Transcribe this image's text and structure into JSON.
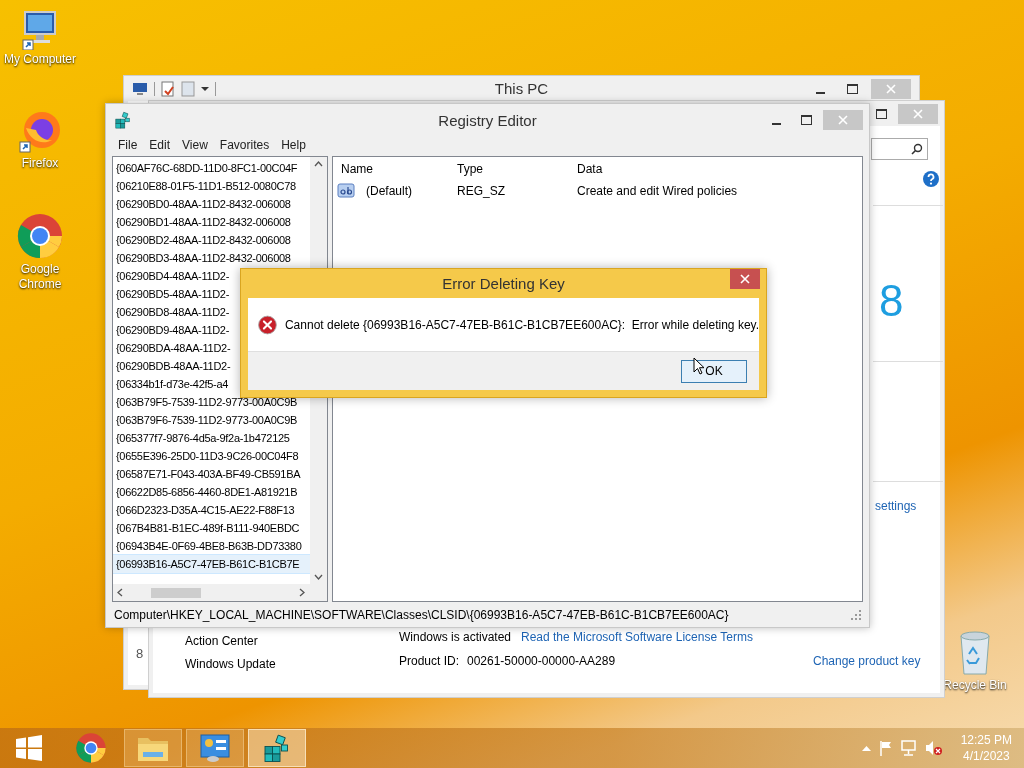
{
  "desktop_icons": [
    {
      "label": "My Computer",
      "kind": "computer"
    },
    {
      "label": "Firefox",
      "kind": "firefox"
    },
    {
      "label": "Google Chrome",
      "kind": "chrome"
    },
    {
      "label": "Recycle Bin",
      "kind": "recycle"
    }
  ],
  "this_pc_window": {
    "title": "This PC",
    "edge_text": "8"
  },
  "system_window": {
    "logo_text": "8",
    "settings_link": "settings",
    "sidebar_links": [
      "Action Center",
      "Windows Update"
    ],
    "activation_status": "Windows is activated",
    "license_link": "Read the Microsoft Software License Terms",
    "product_id_label": "Product ID:",
    "product_id": "00261-50000-00000-AA289",
    "change_key_link": "Change product key"
  },
  "registry_editor": {
    "title": "Registry Editor",
    "menu": [
      "File",
      "Edit",
      "View",
      "Favorites",
      "Help"
    ],
    "tree_items": [
      {
        "label": "{060AF76C-68DD-11D0-8FC1-00C04F",
        "selected": false
      },
      {
        "label": "{06210E88-01F5-11D1-B512-0080C78",
        "selected": false
      },
      {
        "label": "{06290BD0-48AA-11D2-8432-006008",
        "selected": false
      },
      {
        "label": "{06290BD1-48AA-11D2-8432-006008",
        "selected": false
      },
      {
        "label": "{06290BD2-48AA-11D2-8432-006008",
        "selected": false
      },
      {
        "label": "{06290BD3-48AA-11D2-8432-006008",
        "selected": false
      },
      {
        "label": "{06290BD4-48AA-11D2-",
        "selected": false
      },
      {
        "label": "{06290BD5-48AA-11D2-",
        "selected": false
      },
      {
        "label": "{06290BD8-48AA-11D2-",
        "selected": false
      },
      {
        "label": "{06290BD9-48AA-11D2-",
        "selected": false
      },
      {
        "label": "{06290BDA-48AA-11D2-",
        "selected": false
      },
      {
        "label": "{06290BDB-48AA-11D2-",
        "selected": false
      },
      {
        "label": "{06334b1f-d73e-42f5-a4",
        "selected": false
      },
      {
        "label": "{063B79F5-7539-11D2-9773-00A0C9B",
        "selected": false
      },
      {
        "label": "{063B79F6-7539-11D2-9773-00A0C9B",
        "selected": false
      },
      {
        "label": "{065377f7-9876-4d5a-9f2a-1b472125",
        "selected": false
      },
      {
        "label": "{0655E396-25D0-11D3-9C26-00C04F8",
        "selected": false
      },
      {
        "label": "{06587E71-F043-403A-BF49-CB591BA",
        "selected": false
      },
      {
        "label": "{06622D85-6856-4460-8DE1-A81921B",
        "selected": false
      },
      {
        "label": "{066D2323-D35A-4C15-AE22-F88F13",
        "selected": false
      },
      {
        "label": "{067B4B81-B1EC-489f-B111-940EBDC",
        "selected": false
      },
      {
        "label": "{06943B4E-0F69-4BE8-B63B-DD73380",
        "selected": false
      },
      {
        "label": "{06993B16-A5C7-47EB-B61C-B1CB7E",
        "selected": true
      }
    ],
    "columns": [
      "Name",
      "Type",
      "Data"
    ],
    "values": [
      {
        "name": "(Default)",
        "type": "REG_SZ",
        "data": "Create and edit Wired policies"
      }
    ],
    "status_path": "Computer\\HKEY_LOCAL_MACHINE\\SOFTWARE\\Classes\\CLSID\\{06993B16-A5C7-47EB-B61C-B1CB7EE600AC}"
  },
  "dialog": {
    "title": "Error Deleting Key",
    "message": "Cannot delete {06993B16-A5C7-47EB-B61C-B1CB7EE600AC}:  Error while deleting key.",
    "button": "OK"
  },
  "taskbar": {
    "items": [
      {
        "kind": "start",
        "running": false,
        "selected": false
      },
      {
        "kind": "chrome",
        "running": false,
        "selected": false
      },
      {
        "kind": "explorer",
        "running": true,
        "selected": false
      },
      {
        "kind": "control-panel",
        "running": true,
        "selected": false
      },
      {
        "kind": "regedit",
        "running": true,
        "selected": true
      }
    ],
    "time": "12:25 PM",
    "date": "4/1/2023"
  }
}
